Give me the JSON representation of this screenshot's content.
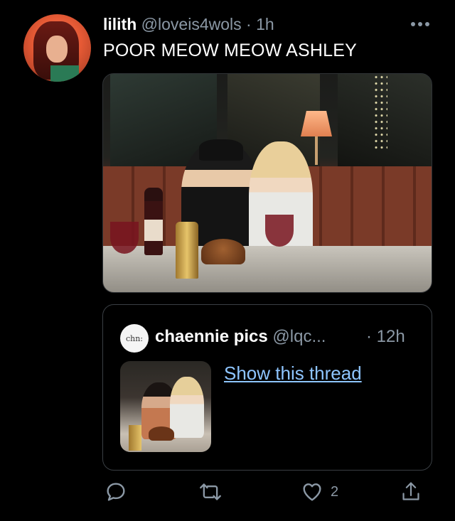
{
  "tweet": {
    "author_name": "lilith",
    "author_handle": "@loveis4wols",
    "separator": "·",
    "time": "1h",
    "text": "POOR MEOW MEOW ASHLEY",
    "more_icon": "more-horizontal-icon"
  },
  "quote": {
    "avatar_text": "chn:",
    "author_name": "chaennie pics",
    "author_handle": "@lqc...",
    "time": "· 12h",
    "link_text": "Show this thread"
  },
  "actions": {
    "reply_icon": "reply-icon",
    "retweet_icon": "retweet-icon",
    "like_icon": "heart-icon",
    "like_count": "2",
    "share_icon": "share-icon"
  },
  "colors": {
    "background": "#000000",
    "text_primary": "#ffffff",
    "text_secondary": "#8b98a5",
    "link": "#8ec5ff",
    "border": "#3a3f44"
  }
}
